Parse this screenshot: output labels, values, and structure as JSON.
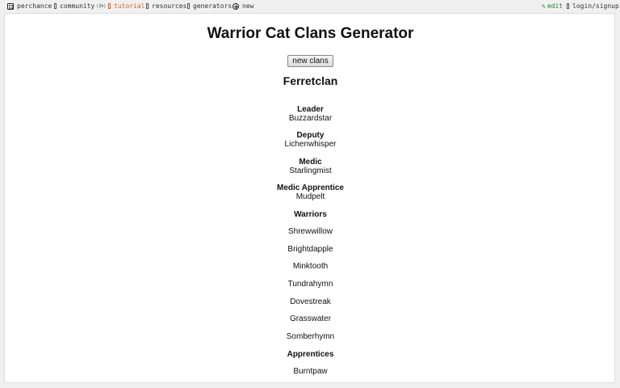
{
  "nav": {
    "brand": "perchance",
    "community": "community",
    "community_count": "(2h)",
    "tutorial": "tutorial",
    "resources": "resources",
    "generators": "generators",
    "new": "new",
    "edit": "edit",
    "login": "login/signup"
  },
  "page": {
    "title": "Warrior Cat Clans Generator",
    "button": "new clans",
    "clan_name": "Ferretclan",
    "leader_label": "Leader",
    "leader": "Buzzardstar",
    "deputy_label": "Deputy",
    "deputy": "Lichenwhisper",
    "medic_label": "Medic",
    "medic": "Starlingmist",
    "medic_apprentice_label": "Medic Apprentice",
    "medic_apprentice": "Mudpelt",
    "warriors_label": "Warriors",
    "warriors": [
      "Shrewwillow",
      "Brightdapple",
      "Minktooth",
      "Tundrahymn",
      "Dovestreak",
      "Grasswater",
      "Somberhymn"
    ],
    "apprentices_label": "Apprentices",
    "apprentices": [
      "Burntpaw"
    ]
  },
  "colors": {
    "tutorial": "#e0651b",
    "edit": "#1b8a1b"
  }
}
